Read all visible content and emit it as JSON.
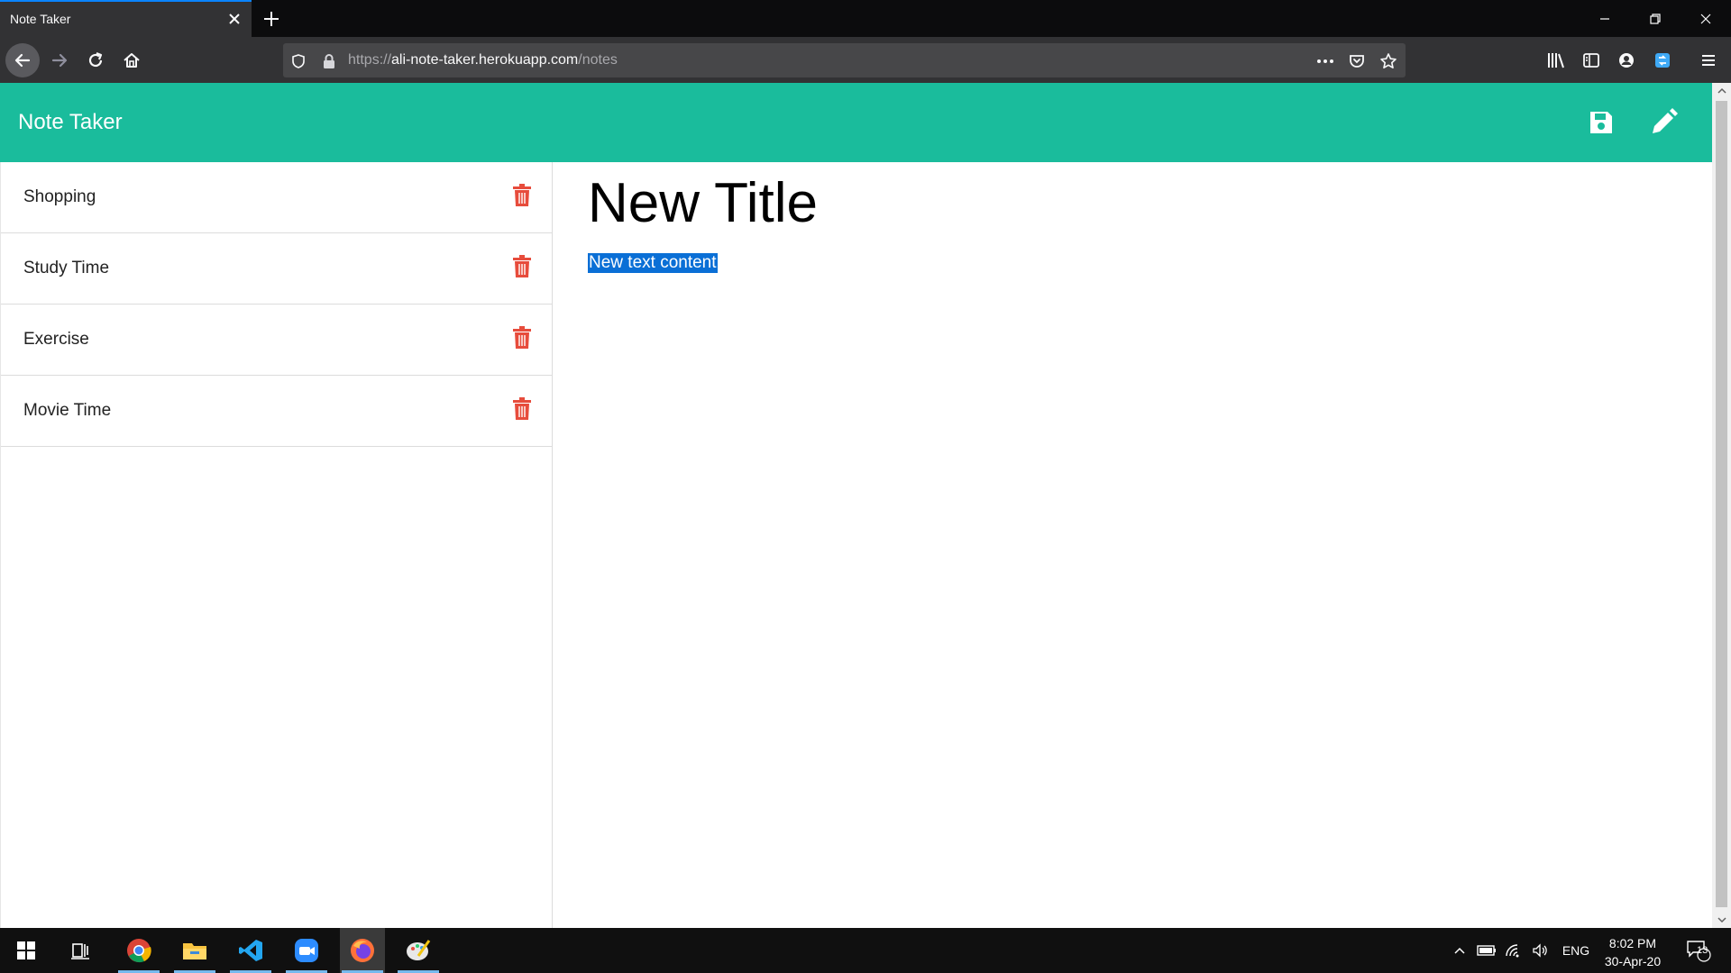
{
  "browser": {
    "tab_title": "Note Taker",
    "url_prefix": "https://",
    "url_host": "ali-note-taker.herokuapp.com",
    "url_path": "/notes",
    "accent": "#0a84ff"
  },
  "app": {
    "brand": "Note Taker",
    "header_color": "#1abc9c",
    "icons": {
      "save": "save-icon",
      "new": "pencil-icon"
    }
  },
  "notes": [
    {
      "title": "Shopping"
    },
    {
      "title": "Study Time"
    },
    {
      "title": "Exercise"
    },
    {
      "title": "Movie Time"
    }
  ],
  "editor": {
    "title": "New Title",
    "body": "New text content"
  },
  "trash_color": "#e74c3c",
  "taskbar": {
    "language": "ENG",
    "time": "8:02 PM",
    "date": "30-Apr-20",
    "notification_count": "13"
  }
}
